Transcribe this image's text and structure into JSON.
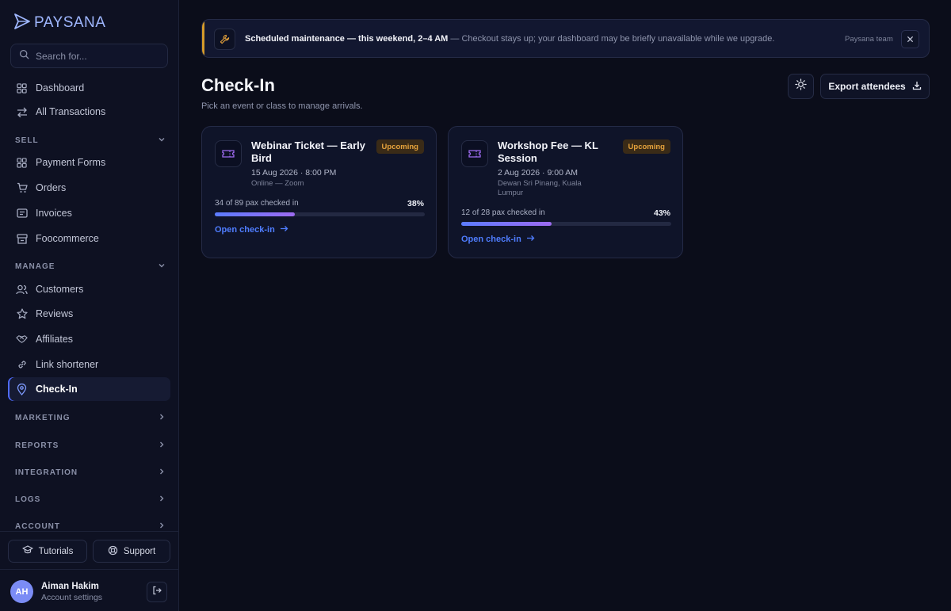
{
  "brand": {
    "name": "PAYSANA"
  },
  "search": {
    "placeholder": "Search for..."
  },
  "sidebar": {
    "top_items": [
      {
        "label": "Dashboard",
        "icon": "grid-icon"
      },
      {
        "label": "All Transactions",
        "icon": "arrows-icon"
      }
    ],
    "sections": [
      {
        "label": "SELL",
        "expanded": true,
        "items": [
          {
            "label": "Payment Forms",
            "icon": "grid-icon"
          },
          {
            "label": "Orders",
            "icon": "cart-icon"
          },
          {
            "label": "Invoices",
            "icon": "invoice-icon"
          },
          {
            "label": "Foocommerce",
            "icon": "store-icon"
          }
        ]
      },
      {
        "label": "MANAGE",
        "expanded": true,
        "items": [
          {
            "label": "Customers",
            "icon": "users-icon"
          },
          {
            "label": "Reviews",
            "icon": "star-icon"
          },
          {
            "label": "Affiliates",
            "icon": "handshake-icon"
          },
          {
            "label": "Link shortener",
            "icon": "link-icon"
          },
          {
            "label": "Check-In",
            "icon": "location-pin-icon",
            "active": true
          }
        ]
      },
      {
        "label": "MARKETING",
        "expanded": false
      },
      {
        "label": "REPORTS",
        "expanded": false
      },
      {
        "label": "INTEGRATION",
        "expanded": false
      },
      {
        "label": "LOGS",
        "expanded": false
      },
      {
        "label": "ACCOUNT",
        "expanded": false
      }
    ],
    "footer": {
      "tutorials_label": "Tutorials",
      "support_label": "Support"
    },
    "user": {
      "initials": "AH",
      "name": "Aiman Hakim",
      "subtitle": "Account settings"
    }
  },
  "banner": {
    "title": "Scheduled maintenance — this weekend, 2–4 AM",
    "message": "— Checkout stays up; your dashboard may be briefly unavailable while we upgrade.",
    "author": "Paysana team",
    "accent_color": "#d49a2a"
  },
  "page": {
    "title": "Check-In",
    "subtitle": "Pick an event or class to manage arrivals.",
    "export_label": "Export attendees"
  },
  "events": [
    {
      "title": "Webinar Ticket — Early Bird",
      "badge": "Upcoming",
      "date": "15 Aug 2026 · 8:00 PM",
      "venue": "Online — Zoom",
      "progress_label": "34 of 89 pax checked in",
      "percent_label": "38%",
      "progress": 0.38,
      "link_label": "Open check-in"
    },
    {
      "title": "Workshop Fee — KL Session",
      "badge": "Upcoming",
      "date": "2 Aug 2026 · 9:00 AM",
      "venue": "Dewan Sri Pinang, Kuala Lumpur",
      "progress_label": "12 of 28 pax checked in",
      "percent_label": "43%",
      "progress": 0.43,
      "link_label": "Open check-in"
    }
  ],
  "colors": {
    "accent": "#4f7dff",
    "badge_text": "#e6a33c",
    "background": "#0b0d1a"
  }
}
